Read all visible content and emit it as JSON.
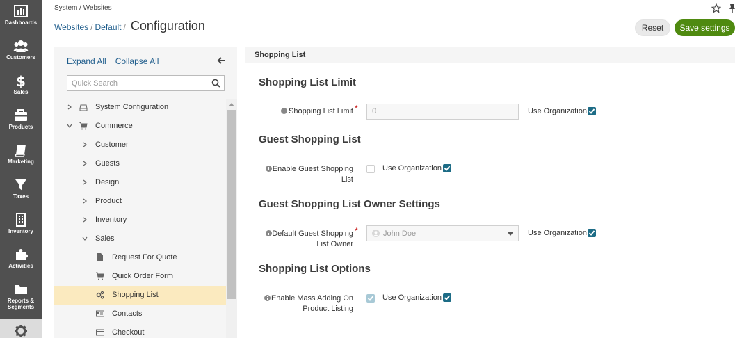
{
  "nav": {
    "items": [
      {
        "label": "Dashboards",
        "icon": "bar-chart-icon"
      },
      {
        "label": "Customers",
        "icon": "users-icon"
      },
      {
        "label": "Sales",
        "icon": "dollar-icon"
      },
      {
        "label": "Products",
        "icon": "briefcase-icon"
      },
      {
        "label": "Marketing",
        "icon": "book-icon"
      },
      {
        "label": "Taxes",
        "icon": "filter-icon"
      },
      {
        "label": "Inventory",
        "icon": "building-icon"
      },
      {
        "label": "Activities",
        "icon": "puzzle-icon"
      },
      {
        "label": "Reports &",
        "label2": "Segments",
        "icon": "folder-icon"
      },
      {
        "label": "",
        "icon": "gear-icon"
      }
    ]
  },
  "header": {
    "breadcrumb": "System / Websites",
    "crumbs": [
      "Websites",
      "Default"
    ],
    "separator": "/",
    "title": "Configuration",
    "reset_label": "Reset",
    "save_label": "Save settings"
  },
  "tree": {
    "expand_all": "Expand All",
    "collapse_all": "Collapse All",
    "search_placeholder": "Quick Search",
    "items": [
      {
        "label": "System Configuration",
        "level": 0,
        "arrow": "right",
        "icon": "drive-icon"
      },
      {
        "label": "Commerce",
        "level": 0,
        "arrow": "down",
        "icon": "cart-icon"
      },
      {
        "label": "Customer",
        "level": 1,
        "arrow": "right"
      },
      {
        "label": "Guests",
        "level": 1,
        "arrow": "right"
      },
      {
        "label": "Design",
        "level": 1,
        "arrow": "right"
      },
      {
        "label": "Product",
        "level": 1,
        "arrow": "right"
      },
      {
        "label": "Inventory",
        "level": 1,
        "arrow": "right"
      },
      {
        "label": "Sales",
        "level": 1,
        "arrow": "down"
      },
      {
        "label": "Request For Quote",
        "level": 2,
        "icon": "file-icon"
      },
      {
        "label": "Quick Order Form",
        "level": 2,
        "icon": "cart-icon"
      },
      {
        "label": "Shopping List",
        "level": 2,
        "icon": "cogs-icon",
        "selected": true
      },
      {
        "label": "Contacts",
        "level": 2,
        "icon": "contact-card-icon"
      },
      {
        "label": "Checkout",
        "level": 2,
        "icon": "credit-card-icon"
      }
    ]
  },
  "content": {
    "section_title": "Shopping List",
    "use_org_label": "Use Organization",
    "groups": [
      {
        "title": "Shopping List Limit",
        "field": {
          "label": "Shopping List Limit",
          "required": true,
          "type": "text",
          "value": "0"
        }
      },
      {
        "title": "Guest Shopping List",
        "field": {
          "label_lines": [
            "Enable Guest Shopping",
            "List"
          ],
          "required": false,
          "type": "checkbox",
          "checked": false
        }
      },
      {
        "title": "Guest Shopping List Owner Settings",
        "field": {
          "label_lines": [
            "Default Guest Shopping",
            "List Owner"
          ],
          "required": true,
          "type": "select",
          "value": "John Doe"
        }
      },
      {
        "title": "Shopping List Options",
        "field": {
          "label_lines": [
            "Enable Mass Adding On",
            "Product Listing"
          ],
          "required": false,
          "type": "checkbox",
          "checked": true
        }
      }
    ]
  },
  "colors": {
    "nav_bg": "#505050",
    "link": "#1f5d8c",
    "save_button": "#4f8a10",
    "checkbox": "#1d6c86",
    "selected_row": "#fbeabf"
  }
}
